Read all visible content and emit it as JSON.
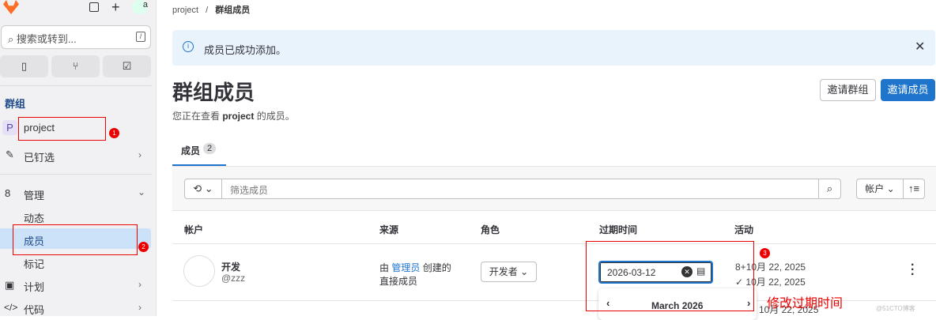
{
  "sidebar": {
    "search_placeholder": "搜索或转到...",
    "search_kbd": "/",
    "group_heading": "群组",
    "project_avatar": "P",
    "project": "project",
    "pinned": "已钉选",
    "manage": "管理",
    "activity": "动态",
    "members": "成员",
    "labels": "标记",
    "plan": "计划",
    "code": "代码",
    "avatar_alt": "a"
  },
  "breadcrumb": {
    "root": "project",
    "sep": "/",
    "current": "群组成员"
  },
  "alert": {
    "text": "成员已成功添加。"
  },
  "page": {
    "title": "群组成员",
    "subtitle_pre": "您正在查看 ",
    "subtitle_bold": "project",
    "subtitle_post": " 的成员。",
    "invite_group": "邀请群组",
    "invite_members": "邀请成员"
  },
  "tab": {
    "label": "成员",
    "count": "2"
  },
  "filter": {
    "placeholder": "筛选成员",
    "sort_label": "帐户"
  },
  "table": {
    "headers": [
      "帐户",
      "来源",
      "角色",
      "过期时间",
      "活动"
    ],
    "row": {
      "name": "开发",
      "username": "@zzz",
      "source_pre": "由 ",
      "source_link": "管理员",
      "source_post": " 创建的",
      "source_line2": "直接成员",
      "role": "开发者",
      "expiry": "2026-03-12",
      "activity1": "10月 22, 2025",
      "activity2": "10月 22, 2025",
      "activity3": "10月 22, 2025"
    }
  },
  "datepicker": {
    "month": "March",
    "year": "2026"
  },
  "annotations": {
    "b1": "1",
    "b2": "2",
    "b3": "3",
    "note": "修改过期时间"
  },
  "watermark": "@51CTO博客"
}
